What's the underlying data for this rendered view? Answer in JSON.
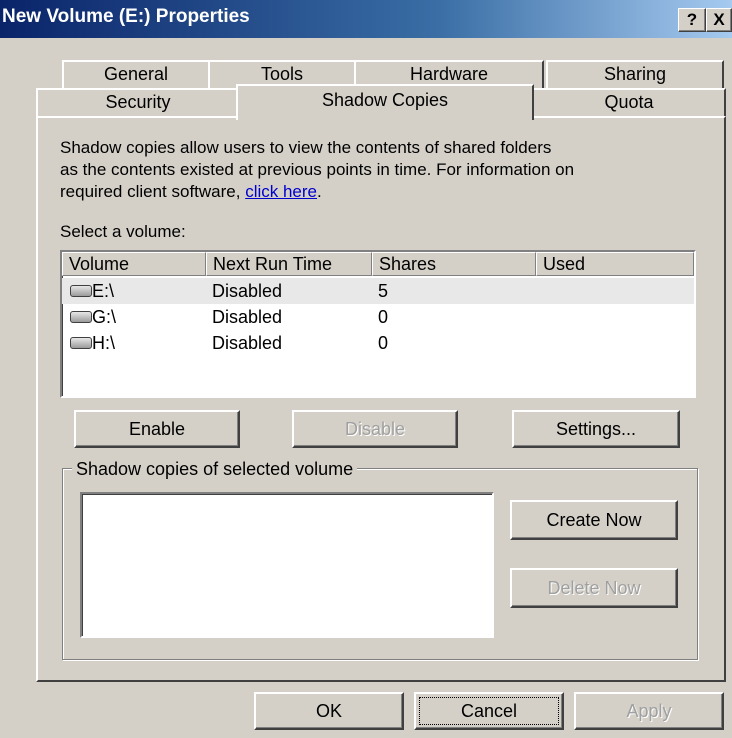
{
  "window": {
    "title": "New Volume (E:) Properties",
    "help_button": "?",
    "close_button": "X"
  },
  "tabs": {
    "row1": [
      "General",
      "Tools",
      "Hardware",
      "Sharing"
    ],
    "row2": [
      "Security",
      "Shadow Copies",
      "Quota"
    ],
    "active": "Shadow Copies"
  },
  "description": {
    "line1": "Shadow copies allow users to view the contents of shared folders",
    "line2": "as the contents existed at previous points in time. For information on",
    "line3_prefix": "required client software, ",
    "link_text": "click here",
    "line3_suffix": "."
  },
  "volumes": {
    "label": "Select a volume:",
    "columns": [
      "Volume",
      "Next Run Time",
      "Shares",
      "Used"
    ],
    "rows": [
      {
        "volume": "E:\\",
        "next_run": "Disabled",
        "shares": "5",
        "used": "",
        "selected": true
      },
      {
        "volume": "G:\\",
        "next_run": "Disabled",
        "shares": "0",
        "used": "",
        "selected": false
      },
      {
        "volume": "H:\\",
        "next_run": "Disabled",
        "shares": "0",
        "used": "",
        "selected": false
      }
    ],
    "icon": "drive-icon"
  },
  "actions": {
    "enable": "Enable",
    "disable": "Disable",
    "settings": "Settings..."
  },
  "shadow_group": {
    "label": "Shadow copies of selected volume",
    "create_now": "Create Now",
    "delete_now": "Delete Now"
  },
  "footer": {
    "ok": "OK",
    "cancel": "Cancel",
    "apply": "Apply"
  },
  "colors": {
    "face": "#d4d0c8",
    "title_start": "#0a246a",
    "title_end": "#a6caf0",
    "link": "#0000cc"
  }
}
